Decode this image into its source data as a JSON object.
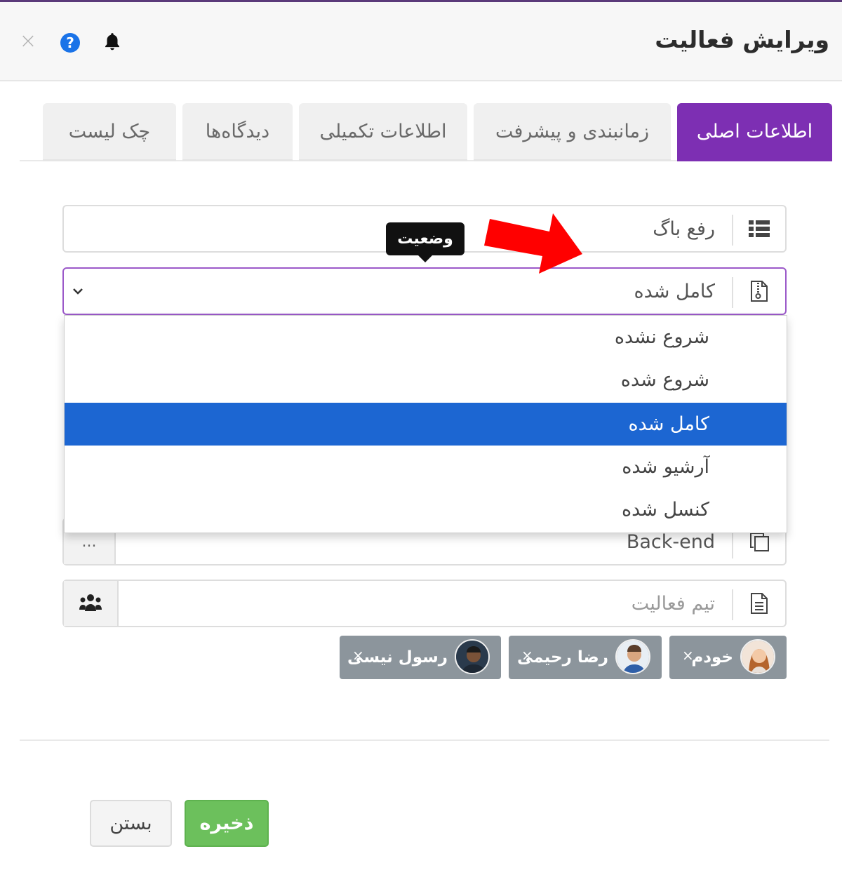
{
  "modal": {
    "title": "ویرایش فعالیت",
    "close_icon": "×",
    "help_icon": "?"
  },
  "tabs": [
    {
      "label": "اطلاعات اصلی",
      "active": true
    },
    {
      "label": "زمانبندی و پیشرفت",
      "active": false
    },
    {
      "label": "اطلاعات تکمیلی",
      "active": false
    },
    {
      "label": "دیدگاه‌ها",
      "active": false
    },
    {
      "label": "چک لیست",
      "active": false
    }
  ],
  "fields": {
    "type": {
      "value": "رفع باگ",
      "icon": "list-icon"
    },
    "status": {
      "value": "کامل شده",
      "icon": "file-zip-icon",
      "tooltip": "وضعیت"
    },
    "category": {
      "value": "Back-end",
      "icon": "copy-icon",
      "more": "..."
    },
    "team": {
      "placeholder": "تیم فعالیت",
      "icon": "document-icon",
      "button_icon": "users-icon"
    }
  },
  "status_options": [
    {
      "label": "شروع نشده",
      "selected": false
    },
    {
      "label": "شروع شده",
      "selected": false
    },
    {
      "label": "کامل شده",
      "selected": true
    },
    {
      "label": "آرشیو شده",
      "selected": false
    },
    {
      "label": "کنسل شده",
      "selected": false
    }
  ],
  "team_members": [
    {
      "name": "خودم",
      "remove": "×"
    },
    {
      "name": "رضا رحیمی",
      "remove": "×"
    },
    {
      "name": "رسول نیسی",
      "remove": "×"
    }
  ],
  "buttons": {
    "save": "ذخیره",
    "close": "بستن"
  },
  "colors": {
    "accent": "#7d2fb3",
    "selected_option": "#1c66d2",
    "save": "#6cc05c",
    "annotation_arrow": "#ff0000"
  }
}
